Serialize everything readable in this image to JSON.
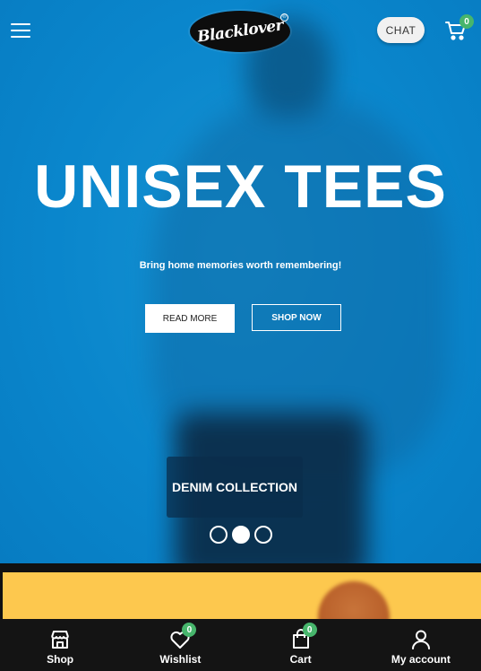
{
  "header": {
    "menu_icon": "hamburger-menu-icon",
    "logo_text": "Blacklover",
    "logo_mark": "®",
    "chat_label": "CHAT",
    "cart_count": "0",
    "cart_icon": "cart-icon"
  },
  "hero": {
    "title": "UNISEX TEES",
    "subtitle": "Bring home memories worth remembering!",
    "read_more_label": "READ MORE",
    "shop_now_label": "SHOP NOW",
    "collection_label": "DENIM COLLECTION",
    "slides_total": 3,
    "active_slide": 2
  },
  "colors": {
    "hero_blue": "#0a86cc",
    "badge_green": "#47b56c",
    "banner_yellow": "#fdc84e",
    "nav_bg": "#141414"
  },
  "bottom_nav": {
    "items": [
      {
        "label": "Shop",
        "icon": "store-icon"
      },
      {
        "label": "Wishlist",
        "icon": "heart-icon",
        "badge": "0"
      },
      {
        "label": "Cart",
        "icon": "shopping-bag-icon",
        "badge": "0"
      },
      {
        "label": "My account",
        "icon": "user-icon"
      }
    ]
  }
}
